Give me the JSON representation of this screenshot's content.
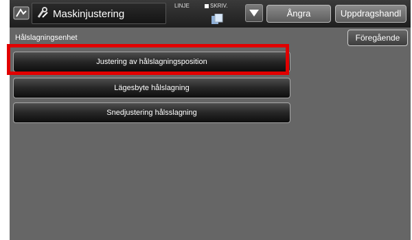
{
  "header": {
    "title": "Maskinjustering",
    "linje_label": "LINJE",
    "skriv_label": "SKRIV.",
    "undo_label": "Ångra",
    "job_label": "Uppdragshandl"
  },
  "section": {
    "label": "Hålslagningsenhet",
    "back_label": "Föregående"
  },
  "menu": {
    "items": [
      {
        "label": "Justering av hålslagningsposition",
        "highlighted": true
      },
      {
        "label": "Lägesbyte hålslagning"
      },
      {
        "label": "Snedjustering hålsslagning"
      }
    ]
  },
  "colors": {
    "highlight": "#e10000",
    "background": "#666666"
  }
}
